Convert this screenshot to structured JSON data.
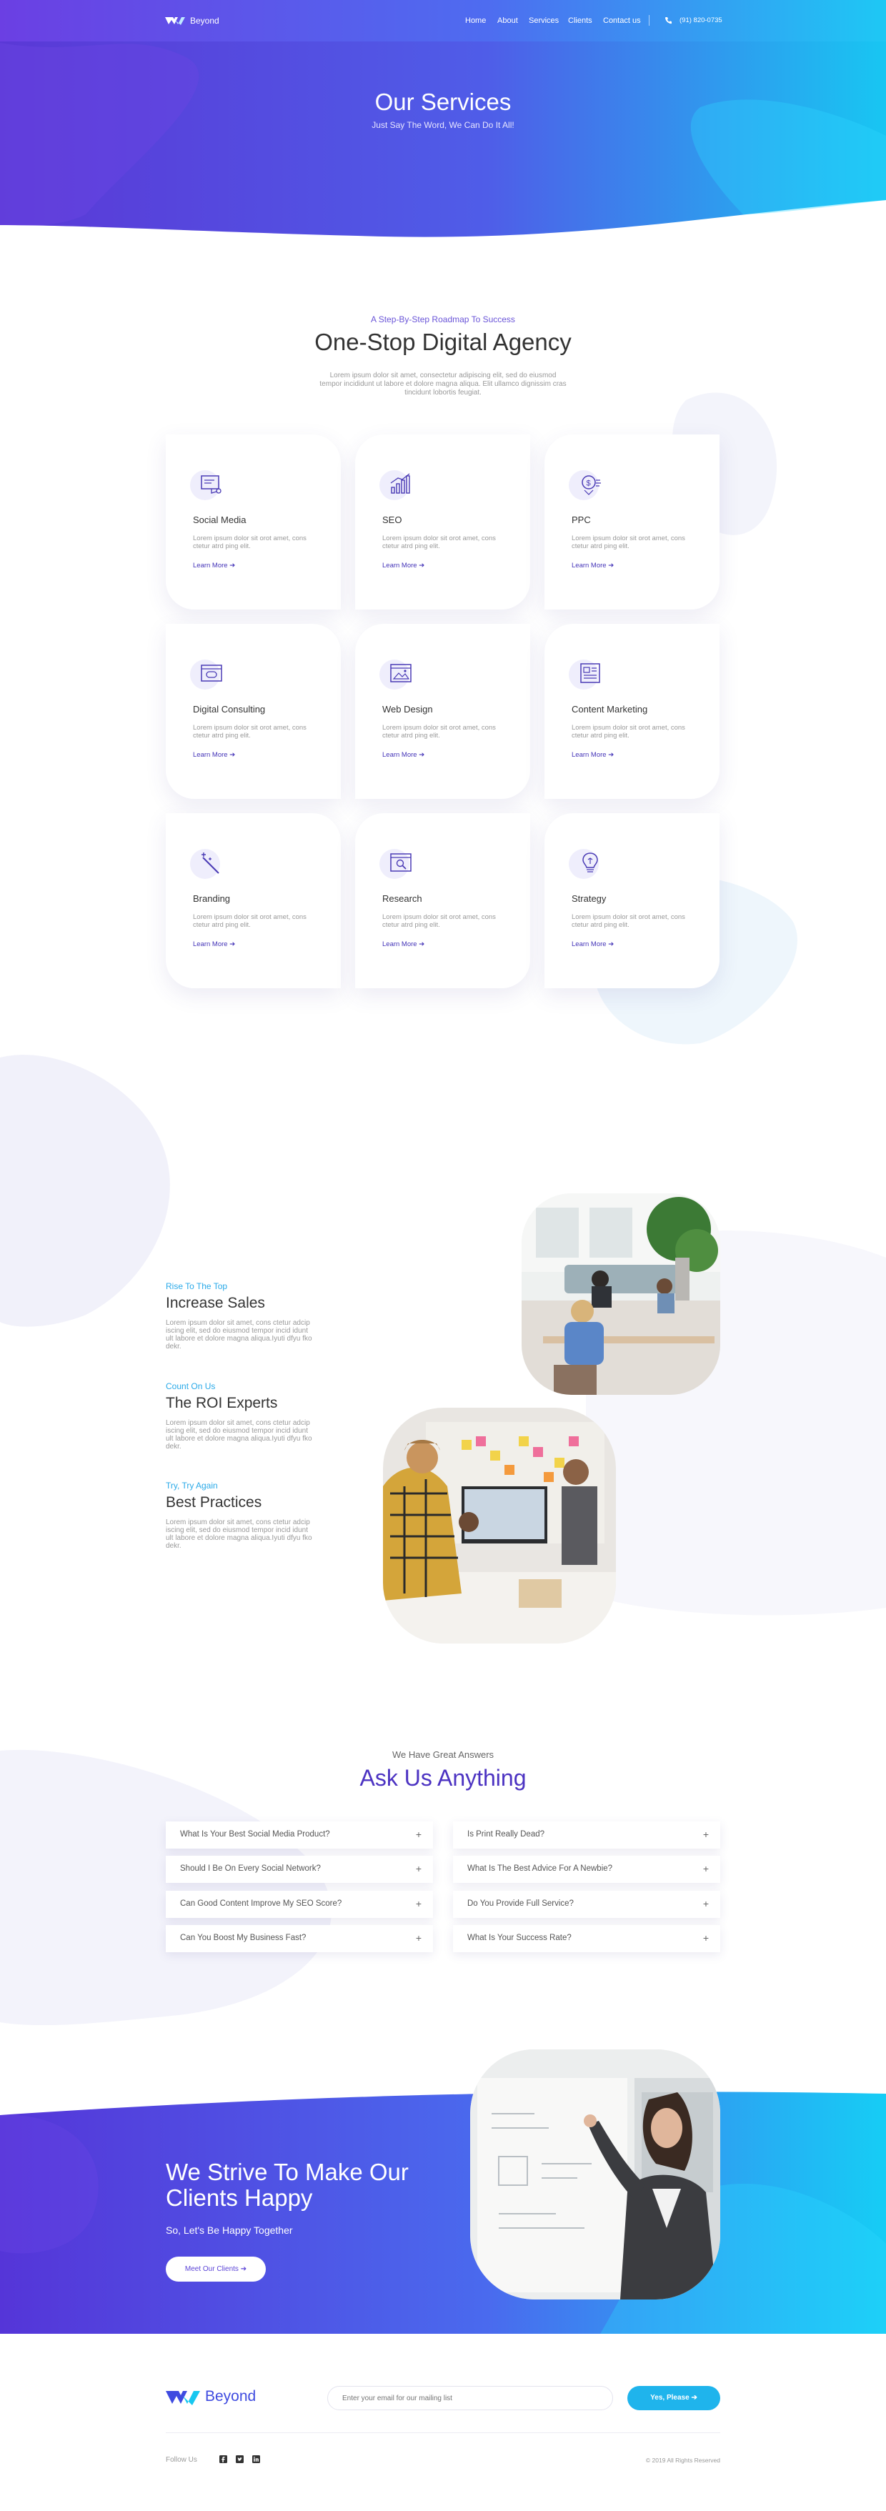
{
  "brand": {
    "name": "Beyond"
  },
  "nav": {
    "items": [
      "Home",
      "About",
      "Services",
      "Clients",
      "Contact us"
    ],
    "phone": "(91) 820-0735"
  },
  "hero": {
    "title": "Our Services",
    "subtitle": "Just Say The Word, We Can Do It All!"
  },
  "intro": {
    "kicker": "A Step-By-Step Roadmap To Success",
    "title": "One-Stop Digital Agency",
    "text": "Lorem ipsum dolor sit amet, consectetur adipiscing elit, sed do eiusmod tempor incididunt ut labore et dolore magna aliqua. Elit ullamco dignissim cras tincidunt lobortis feugiat."
  },
  "services": [
    {
      "name": "Social Media",
      "icon": "social-media-icon",
      "text": "Lorem ipsum dolor sit orot amet, cons ctetur atrd ping elit.",
      "link": "Learn More"
    },
    {
      "name": "SEO",
      "icon": "seo-chart-icon",
      "text": "Lorem ipsum dolor sit orot amet, cons ctetur atrd ping elit.",
      "link": "Learn More"
    },
    {
      "name": "PPC",
      "icon": "ppc-money-icon",
      "text": "Lorem ipsum dolor sit orot amet, cons ctetur atrd ping elit.",
      "link": "Learn More"
    },
    {
      "name": "Digital Consulting",
      "icon": "consulting-chat-icon",
      "text": "Lorem ipsum dolor sit orot amet, cons ctetur atrd ping elit.",
      "link": "Learn More"
    },
    {
      "name": "Web Design",
      "icon": "web-design-icon",
      "text": "Lorem ipsum dolor sit orot amet, cons ctetur atrd ping elit.",
      "link": "Learn More"
    },
    {
      "name": "Content Marketing",
      "icon": "content-document-icon",
      "text": "Lorem ipsum dolor sit orot amet, cons ctetur atrd ping elit.",
      "link": "Learn More"
    },
    {
      "name": "Branding",
      "icon": "branding-wand-icon",
      "text": "Lorem ipsum dolor sit orot amet, cons ctetur atrd ping elit.",
      "link": "Learn More"
    },
    {
      "name": "Research",
      "icon": "research-search-icon",
      "text": "Lorem ipsum dolor sit orot amet, cons ctetur atrd ping elit.",
      "link": "Learn More"
    },
    {
      "name": "Strategy",
      "icon": "strategy-bulb-icon",
      "text": "Lorem ipsum dolor sit orot amet, cons ctetur atrd ping elit.",
      "link": "Learn More"
    }
  ],
  "features": [
    {
      "kicker": "Rise To The Top",
      "title": "Increase Sales",
      "text": "Lorem ipsum dolor sit amet, cons ctetur adcip iscing elit, sed do eiusmod tempor incid idunt ult labore et dolore magna aliqua.Iyuti dfyu fko dekr."
    },
    {
      "kicker": "Count On Us",
      "title": "The ROI Experts",
      "text": "Lorem ipsum dolor sit amet, cons ctetur adcip iscing elit, sed do eiusmod tempor incid idunt ult labore et dolore magna aliqua.Iyuti dfyu fko dekr."
    },
    {
      "kicker": "Try, Try Again",
      "title": "Best Practices",
      "text": "Lorem ipsum dolor sit amet, cons ctetur adcip iscing elit, sed do eiusmod tempor incid idunt ult labore et dolore magna aliqua.Iyuti dfyu fko dekr."
    }
  ],
  "faq": {
    "kicker": "We Have Great Answers",
    "title": "Ask Us Anything",
    "left": [
      "What Is Your Best Social Media Product?",
      "Should I Be On Every Social Network?",
      "Can Good Content Improve My SEO Score?",
      "Can You Boost My Business Fast?"
    ],
    "right": [
      "Is Print Really Dead?",
      "What Is The Best Advice For A Newbie?",
      "Do You Provide Full Service?",
      "What Is Your Success Rate?"
    ],
    "expand_symbol": "+"
  },
  "cta": {
    "title": "We Strive To Make Our Clients Happy",
    "subtitle": "So, Let's Be Happy Together",
    "button": "Meet Our Clients"
  },
  "footer": {
    "email_placeholder": "Enter your email for our mailing list",
    "subscribe_button": "Yes, Please",
    "follow_label": "Follow Us",
    "socials": [
      "facebook-icon",
      "twitter-icon",
      "linkedin-icon"
    ],
    "copyright": "© 2019 All Rights Reserved"
  },
  "colors": {
    "primary": "#5b3fdc",
    "accent": "#1ec8f4",
    "text": "#333333",
    "muted": "#999999"
  }
}
